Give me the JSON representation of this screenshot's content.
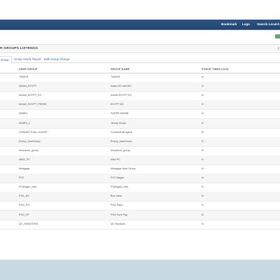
{
  "topnav": {
    "items": [
      {
        "label": "Bookmark"
      },
      {
        "label": "Logs"
      },
      {
        "label": "Search Local"
      },
      {
        "label": "A"
      }
    ]
  },
  "panel": {
    "title": "R GROUPS LISTENGS"
  },
  "tabs": [
    {
      "label": "Group"
    },
    {
      "label": "Group Hourly Report"
    },
    {
      "label": "Bulk Group Change"
    }
  ],
  "table": {
    "columns": [
      "USER GROUP",
      "GROUP NAME",
      "FORCE TIMECLOCK"
    ],
    "rows": [
      [
        "7000ER",
        "7000ER",
        "N"
      ],
      [
        "ADAM_EGYPT",
        "Adam EG and BO",
        "N"
      ],
      [
        "ADAM_EGYPT_EC",
        "ADAM EGYPT EC",
        "N"
      ],
      [
        "ADAM_EGYPT_FRERE",
        "EGYPT BO",
        "N"
      ],
      [
        "ADMIN",
        "SUPER ADMIN",
        "N"
      ],
      [
        "ADMIN_L",
        "Jimmy Group",
        "N"
      ],
      [
        "CONNECTCALL AGENT",
        "ConnectCall Agent",
        "N"
      ],
      [
        "Emmy_UserGroup",
        "Emmy_UserGroup",
        "N"
      ],
      [
        "Insurance_group",
        "Insurance_group",
        "N"
      ],
      [
        "MIKE_PC",
        "Mike PC",
        "N"
      ],
      [
        "Mortgage",
        "Mortgage User Group",
        "N"
      ],
      [
        "PC2",
        "PC2 Magan",
        "N"
      ],
      [
        "PCMogan_new",
        "PCMogan_new",
        "N"
      ],
      [
        "PSG_BV",
        "Bux Vaba",
        "N"
      ],
      [
        "PSG_PG",
        "PSG Pays",
        "N"
      ],
      [
        "PSG_PP",
        "PSG Pure Pay",
        "N"
      ],
      [
        "QC_MONITORS",
        "QC Monitors",
        "N"
      ]
    ]
  },
  "colors": {
    "nav": "#22456f",
    "accent": "#3a6ea5",
    "footer": "#c8dbe2"
  }
}
